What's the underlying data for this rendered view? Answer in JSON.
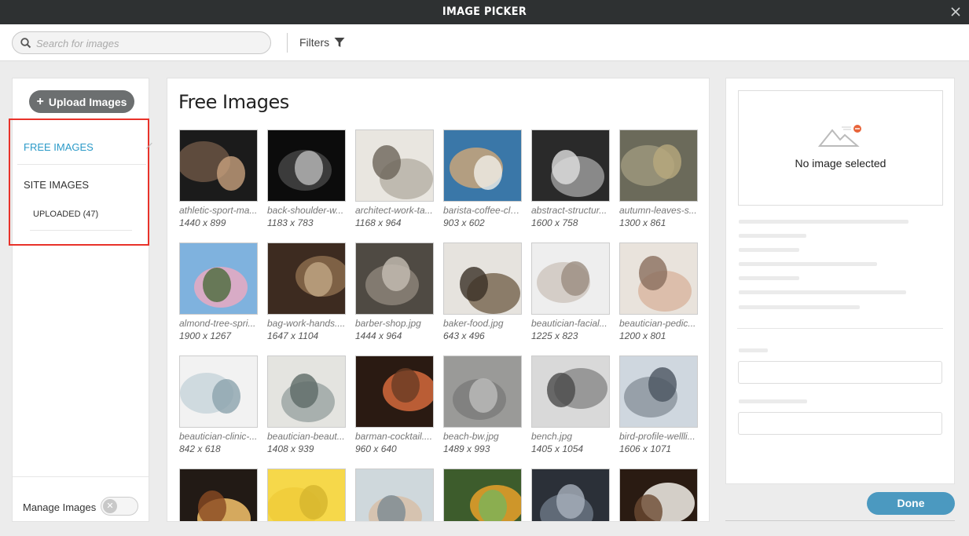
{
  "window": {
    "title": "IMAGE PICKER"
  },
  "toolbar": {
    "search_placeholder": "Search for images",
    "filters_label": "Filters"
  },
  "sidebar": {
    "upload_label": "Upload Images",
    "free_images": "FREE IMAGES",
    "site_images": "SITE IMAGES",
    "uploaded": "UPLOADED (47)",
    "manage_label": "Manage Images",
    "manage_toggle_on": false
  },
  "main": {
    "title": "Free Images",
    "images": [
      {
        "name": "athletic-sport-ma...",
        "dims": "1440 x 899"
      },
      {
        "name": "back-shoulder-w...",
        "dims": "1183 x 783"
      },
      {
        "name": "architect-work-ta...",
        "dims": "1168 x 964"
      },
      {
        "name": "barista-coffee-clo...",
        "dims": "903 x 602"
      },
      {
        "name": "abstract-structur...",
        "dims": "1600 x 758"
      },
      {
        "name": "autumn-leaves-s...",
        "dims": "1300 x 861"
      },
      {
        "name": "almond-tree-spri...",
        "dims": "1900 x 1267"
      },
      {
        "name": "bag-work-hands....",
        "dims": "1647 x 1104"
      },
      {
        "name": "barber-shop.jpg",
        "dims": "1444 x 964"
      },
      {
        "name": "baker-food.jpg",
        "dims": "643 x 496"
      },
      {
        "name": "beautician-facial...",
        "dims": "1225 x 823"
      },
      {
        "name": "beautician-pedic...",
        "dims": "1200 x 801"
      },
      {
        "name": "beautician-clinic-...",
        "dims": "842 x 618"
      },
      {
        "name": "beautician-beaut...",
        "dims": "1408 x 939"
      },
      {
        "name": "barman-cocktail....",
        "dims": "960 x 640"
      },
      {
        "name": "beach-bw.jpg",
        "dims": "1489 x 993"
      },
      {
        "name": "bench.jpg",
        "dims": "1405 x 1054"
      },
      {
        "name": "bird-profile-wellli...",
        "dims": "1606 x 1071"
      },
      {
        "name": "",
        "dims": ""
      },
      {
        "name": "",
        "dims": ""
      },
      {
        "name": "",
        "dims": ""
      },
      {
        "name": "",
        "dims": ""
      },
      {
        "name": "",
        "dims": ""
      },
      {
        "name": "",
        "dims": ""
      }
    ]
  },
  "details": {
    "no_image": "No image selected"
  },
  "footer": {
    "done_label": "Done"
  },
  "colors": {
    "accent": "#4b99c0",
    "link": "#2b9ac8",
    "highlight": "#e8322a",
    "titlebar": "#2e3132"
  }
}
